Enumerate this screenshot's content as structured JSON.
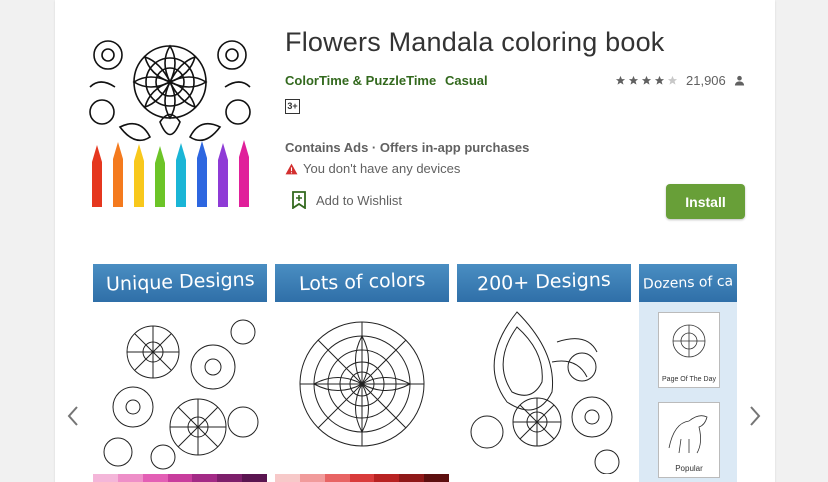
{
  "app": {
    "title": "Flowers Mandala coloring book",
    "developer": "ColorTime & PuzzleTime",
    "genre": "Casual",
    "rating_stars": 4,
    "rating_count": "21,906",
    "content_rating": "3+",
    "ads_info": "Contains Ads · Offers in-app purchases",
    "device_warning": "You don't have any devices",
    "wishlist_label": "Add to Wishlist",
    "install_label": "Install"
  },
  "screenshots": [
    {
      "caption": "Unique Designs"
    },
    {
      "caption": "Lots of colors"
    },
    {
      "caption": "200+ Designs"
    },
    {
      "caption": "Dozens of ca",
      "thumb_labels": [
        "Page Of The Day",
        "Popular"
      ]
    }
  ],
  "colors": {
    "accent_green": "#689f38",
    "developer_green": "#33691e",
    "warning_red": "#d32f2f",
    "banner_blue": "#3d82bb"
  },
  "icons": [
    "star-icon",
    "person-icon",
    "warning-icon",
    "bookmark-add-icon",
    "chevron-left-icon",
    "chevron-right-icon"
  ]
}
